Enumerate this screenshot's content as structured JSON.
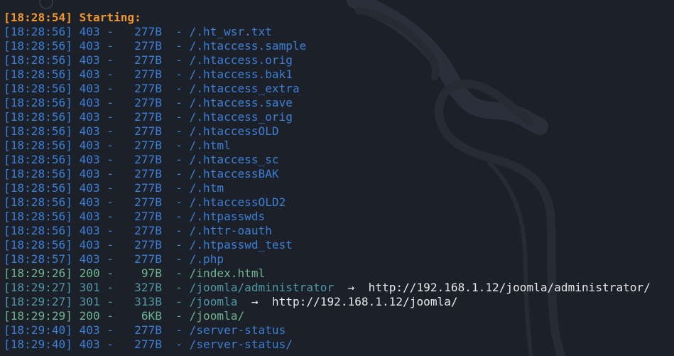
{
  "colors": {
    "background": "#1c2029",
    "header": "#f0972e",
    "status_403": "#3c7fd6",
    "status_301": "#4f96a6",
    "status_200": "#6cb48f",
    "redirect_text": "#e8e8ea",
    "dragon_watermark": "#2a3039"
  },
  "background_logo": "dragon-icon",
  "header": {
    "time": "18:28:54",
    "text": "Starting:"
  },
  "arrow_glyph": "→",
  "rows": [
    {
      "time": "18:28:56",
      "status": "403",
      "size": "277B",
      "path": "/.ht_wsr.txt"
    },
    {
      "time": "18:28:56",
      "status": "403",
      "size": "277B",
      "path": "/.htaccess.sample"
    },
    {
      "time": "18:28:56",
      "status": "403",
      "size": "277B",
      "path": "/.htaccess.orig"
    },
    {
      "time": "18:28:56",
      "status": "403",
      "size": "277B",
      "path": "/.htaccess.bak1"
    },
    {
      "time": "18:28:56",
      "status": "403",
      "size": "277B",
      "path": "/.htaccess_extra"
    },
    {
      "time": "18:28:56",
      "status": "403",
      "size": "277B",
      "path": "/.htaccess.save"
    },
    {
      "time": "18:28:56",
      "status": "403",
      "size": "277B",
      "path": "/.htaccess_orig"
    },
    {
      "time": "18:28:56",
      "status": "403",
      "size": "277B",
      "path": "/.htaccessOLD"
    },
    {
      "time": "18:28:56",
      "status": "403",
      "size": "277B",
      "path": "/.html"
    },
    {
      "time": "18:28:56",
      "status": "403",
      "size": "277B",
      "path": "/.htaccess_sc"
    },
    {
      "time": "18:28:56",
      "status": "403",
      "size": "277B",
      "path": "/.htaccessBAK"
    },
    {
      "time": "18:28:56",
      "status": "403",
      "size": "277B",
      "path": "/.htm"
    },
    {
      "time": "18:28:56",
      "status": "403",
      "size": "277B",
      "path": "/.htaccessOLD2"
    },
    {
      "time": "18:28:56",
      "status": "403",
      "size": "277B",
      "path": "/.htpasswds"
    },
    {
      "time": "18:28:56",
      "status": "403",
      "size": "277B",
      "path": "/.httr-oauth"
    },
    {
      "time": "18:28:56",
      "status": "403",
      "size": "277B",
      "path": "/.htpasswd_test"
    },
    {
      "time": "18:28:57",
      "status": "403",
      "size": "277B",
      "path": "/.php"
    },
    {
      "time": "18:29:26",
      "status": "200",
      "size": "97B",
      "path": "/index.html"
    },
    {
      "time": "18:29:27",
      "status": "301",
      "size": "327B",
      "path": "/joomla/administrator",
      "redirect": "http://192.168.1.12/joomla/administrator/"
    },
    {
      "time": "18:29:27",
      "status": "301",
      "size": "313B",
      "path": "/joomla",
      "redirect": "http://192.168.1.12/joomla/"
    },
    {
      "time": "18:29:29",
      "status": "200",
      "size": "6KB",
      "path": "/joomla/"
    },
    {
      "time": "18:29:40",
      "status": "403",
      "size": "277B",
      "path": "/server-status"
    },
    {
      "time": "18:29:40",
      "status": "403",
      "size": "277B",
      "path": "/server-status/"
    }
  ]
}
